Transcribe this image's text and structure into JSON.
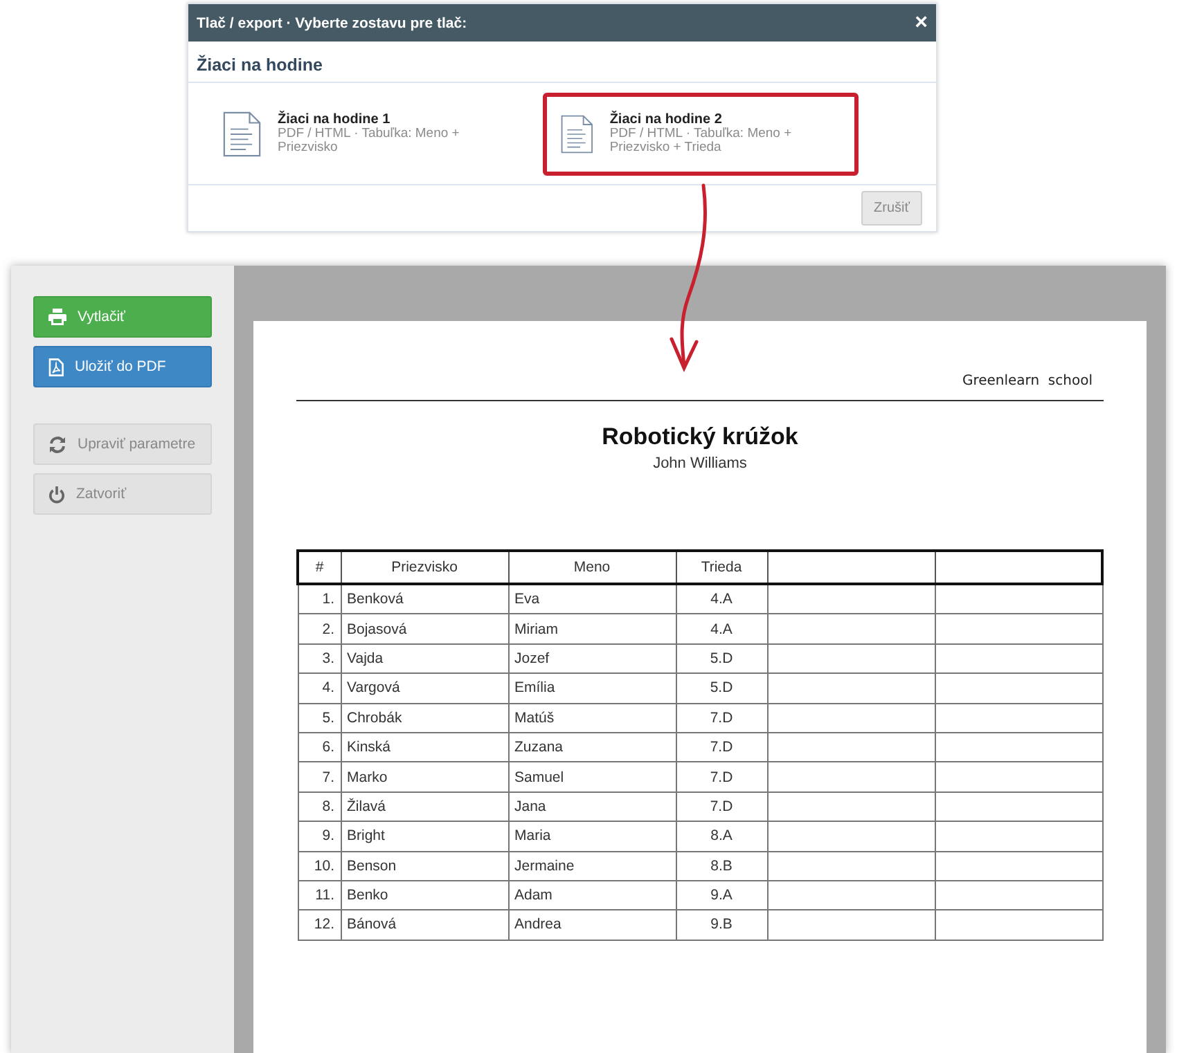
{
  "dialog": {
    "title": "Tlač / export · Vyberte zostavu pre tlač:",
    "close": "×",
    "section_title": "Žiaci na hodine",
    "options": [
      {
        "name": "Žiaci na hodine 1",
        "description": "PDF / HTML · Tabuľka: Meno + Priezvisko",
        "selected": false
      },
      {
        "name": "Žiaci na hodine 2",
        "description": "PDF / HTML · Tabuľka: Meno + Priezvisko + Trieda",
        "selected": true
      }
    ],
    "cancel_button": "Zrušiť"
  },
  "preview": {
    "sidebar": {
      "buttons": [
        {
          "kind": "print",
          "label": "Vytlačiť",
          "disabled": false
        },
        {
          "kind": "pdf",
          "label": "Uložiť do PDF",
          "disabled": false
        },
        {
          "kind": "refresh",
          "label": "Upraviť parametre",
          "disabled": true
        },
        {
          "kind": "power",
          "label": "Zatvoriť",
          "disabled": true
        }
      ]
    },
    "page": {
      "header": "Greenlearn  school",
      "title": "Robotický krúžok",
      "subtitle": "John Williams",
      "table": {
        "columns": [
          "#",
          "Priezvisko",
          "Meno",
          "Trieda"
        ],
        "rows": [
          [
            "1.",
            "Benková",
            "Eva",
            "4.A"
          ],
          [
            "2.",
            "Bojasová",
            "Miriam",
            "4.A"
          ],
          [
            "3.",
            "Vajda",
            "Jozef",
            "5.D"
          ],
          [
            "4.",
            "Vargová",
            "Emília",
            "5.D"
          ],
          [
            "5.",
            "Chrobák",
            "Matúš",
            "7.D"
          ],
          [
            "6.",
            "Kinská",
            "Zuzana",
            "7.D"
          ],
          [
            "7.",
            "Marko",
            "Samuel",
            "7.D"
          ],
          [
            "8.",
            "Žilavá",
            "Jana",
            "7.D"
          ],
          [
            "9.",
            "Bright",
            "Maria",
            "8.A"
          ],
          [
            "10.",
            "Benson",
            "Jermaine",
            "8.B"
          ],
          [
            "11.",
            "Benko",
            "Adam",
            "9.A"
          ],
          [
            "12.",
            "Bánová",
            "Andrea",
            "9.B"
          ]
        ]
      }
    }
  }
}
